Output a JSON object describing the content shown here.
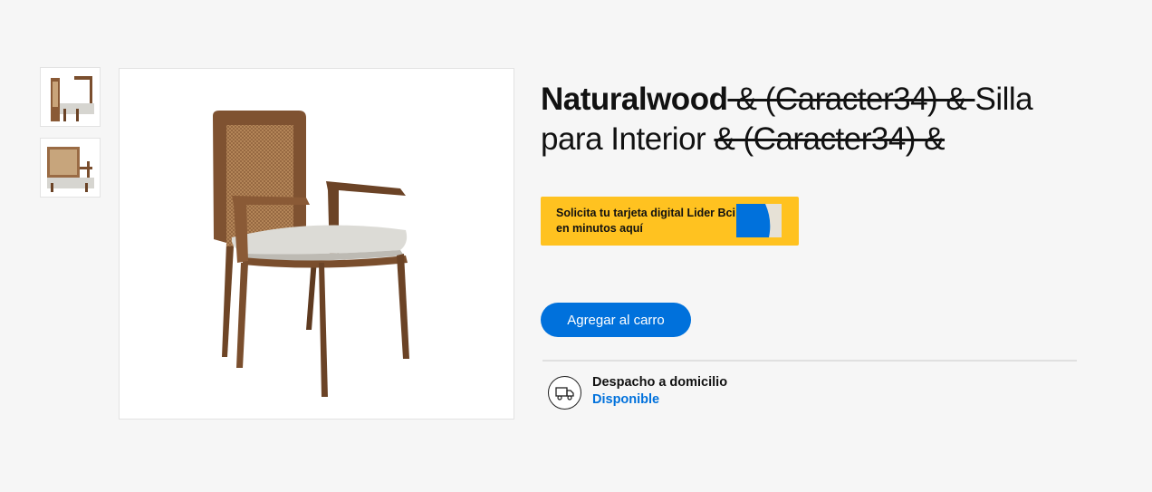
{
  "thumbnails": [
    {
      "alt": "Silla vista frontal"
    },
    {
      "alt": "Silla vista lateral"
    }
  ],
  "product": {
    "brand": "Naturalwood",
    "title_parts": {
      "strike1": " & (Caracter34) & ",
      "middle": "Silla para Interior ",
      "strike2": "& (Caracter34) &"
    }
  },
  "promo": {
    "text": "Solicita tu tarjeta digital Lider Bci en minutos aquí"
  },
  "actions": {
    "add_to_cart": "Agregar al carro"
  },
  "shipping": {
    "title": "Despacho a domicilio",
    "status": "Disponible",
    "icon": "truck-icon"
  },
  "colors": {
    "accent": "#0071dc",
    "promo_bg": "#ffc220",
    "wood": "#7a4e2d",
    "seat": "#d8d7d2"
  }
}
